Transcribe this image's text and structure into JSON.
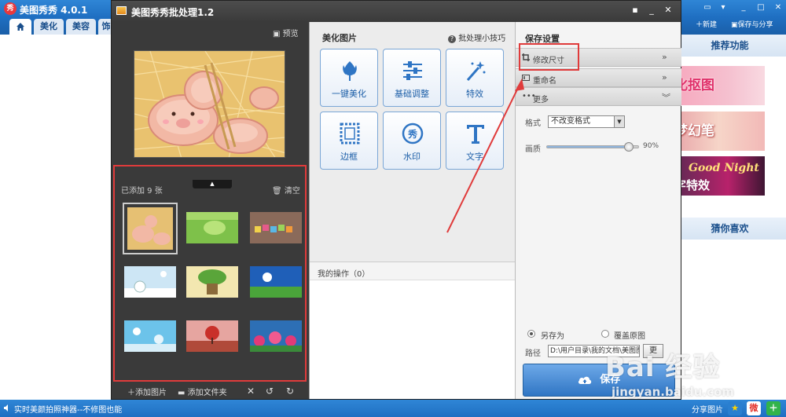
{
  "main_app": {
    "title": "美图秀秀 4.0.1",
    "logo": "秀",
    "tabs": [
      "美化",
      "美容",
      "饰"
    ],
    "toolbar": {
      "new_label": "新建",
      "save_share_label": "保存与分享"
    },
    "right_panel": {
      "recommend_title": "推荐功能",
      "promos": [
        {
          "text": "化抠图"
        },
        {
          "text": "梦幻笔"
        },
        {
          "text": "字特效",
          "subtitle": "Good Night"
        }
      ],
      "guess_title": "猜你喜欢"
    },
    "statusbar": {
      "text": "实时美颜拍照神器--不修图也能",
      "share_label": "分享图片"
    }
  },
  "dialog": {
    "title": "美图秀秀批处理1.2",
    "preview_label": "预览",
    "list": {
      "added_count": "已添加 9 张",
      "clear_label": "清空",
      "thumbnails": [
        "pig-tableware",
        "green-leaf",
        "colorful-letters",
        "snow-cartoon",
        "plant-pot",
        "blue-sky-field",
        "winter-snow",
        "red-tree-field",
        "pink-flowers"
      ]
    },
    "bottom_tools": {
      "add_image": "添加图片",
      "add_folder": "添加文件夹"
    },
    "beautify": {
      "title": "美化图片",
      "tips_label": "批处理小技巧",
      "tools": [
        {
          "label": "一键美化",
          "icon": "tulip-icon"
        },
        {
          "label": "基础调整",
          "icon": "sliders-icon"
        },
        {
          "label": "特效",
          "icon": "magic-wand-icon"
        },
        {
          "label": "边框",
          "icon": "frame-icon"
        },
        {
          "label": "水印",
          "icon": "watermark-icon"
        },
        {
          "label": "文字",
          "icon": "text-icon"
        }
      ],
      "ops_label": "我的操作（0）"
    },
    "save_settings": {
      "title": "保存设置",
      "sections": [
        {
          "label": "修改尺寸",
          "chevron": "»"
        },
        {
          "label": "重命名",
          "chevron": "»"
        },
        {
          "label": "更多",
          "chevron": "︾"
        }
      ],
      "format_label": "格式",
      "format_value": "不改变格式",
      "quality_label": "画质",
      "quality_value": "90%",
      "quality": 0.9,
      "save_as_label": "另存为",
      "overwrite_label": "覆盖原图",
      "path_label": "路径",
      "path_value": "D:\\用户目录\\我的文档\\美图图库",
      "path_change": "更",
      "save_button": "保存"
    }
  },
  "watermark": {
    "logo": "Bai 经验",
    "sub": "jingyan.baidu.com"
  },
  "colors": {
    "accent": "#2f75c4",
    "annotation": "#e03b3b",
    "titlebar": "#1f6fc2"
  }
}
